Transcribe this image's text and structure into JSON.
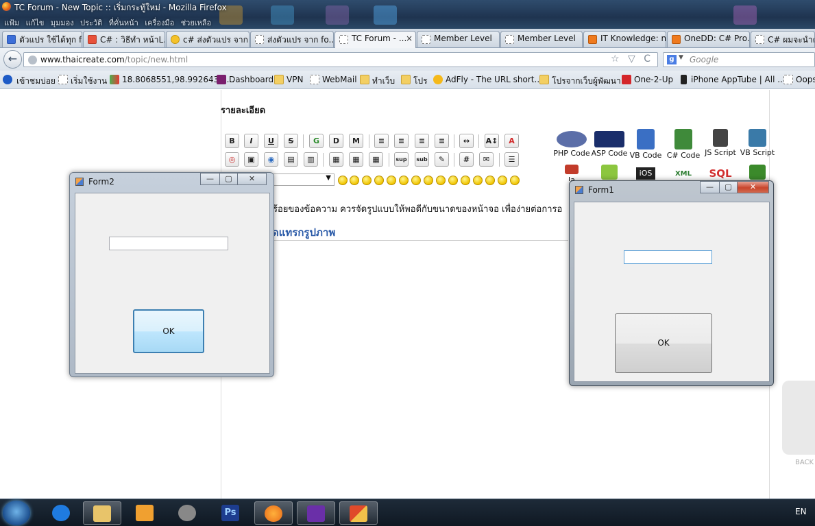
{
  "browser": {
    "window_title": "TC Forum - New Topic :: เริ่มกระทู้ใหม่ - Mozilla Firefox",
    "menu_text": "แฟ้ม แก้ไข มุมมอง ประวัติ ที่คั่นหน้า เครื่องมือ ช่วยเหลือ",
    "tabs": [
      {
        "label": "ตัวแปร ใช้ได้ทุก f...",
        "icon": "google-icon"
      },
      {
        "label": "C# : วิธีทำ หน้าL...",
        "icon": "site-icon"
      },
      {
        "label": "c# ส่งตัวแปร จาก...",
        "icon": "smiley-icon"
      },
      {
        "label": "ส่งตัวแปร จาก fo...",
        "icon": "blank-page-icon"
      },
      {
        "label": "TC Forum - ...",
        "icon": "blank-page-icon",
        "close": "×"
      },
      {
        "label": "Member Level",
        "icon": "blank-page-icon"
      },
      {
        "label": "Member Level",
        "icon": "blank-page-icon"
      },
      {
        "label": "IT Knowledge: n...",
        "icon": "blogger-icon"
      },
      {
        "label": "OneDD: C# Pro...",
        "icon": "blogger-icon"
      },
      {
        "label": "C# ผมจะนำตัว",
        "icon": "blank-page-icon"
      }
    ],
    "url_domain": "www.thaicreate.com",
    "url_path": "/topic/new.html",
    "url_tools": "☆ ▽ C",
    "search_engine_letter": "g",
    "search_placeholder": "Google",
    "bookmarks": [
      {
        "label": "เข้าชมบ่อย",
        "icon": "search-icon"
      },
      {
        "label": "เริ่มใช้งาน",
        "icon": "blank-page-icon"
      },
      {
        "label": "18.8068551,98.9926434 ...",
        "icon": "map-icon"
      },
      {
        "label": "Dashboard",
        "icon": "app-icon"
      },
      {
        "label": "VPN",
        "icon": "folder-icon"
      },
      {
        "label": "WebMail",
        "icon": "blank-page-icon"
      },
      {
        "label": "ทำเว็บ",
        "icon": "folder-icon"
      },
      {
        "label": "โปร",
        "icon": "folder-icon"
      },
      {
        "label": "AdFly - The URL short...",
        "icon": "bee-icon"
      },
      {
        "label": "โปรจากเว็บผู้พัฒนา",
        "icon": "folder-icon"
      },
      {
        "label": "One-2-Up",
        "icon": "up-icon"
      },
      {
        "label": "iPhone AppTube | All ...",
        "icon": "phone-icon"
      },
      {
        "label": "Oops",
        "icon": "blank-page-icon"
      }
    ]
  },
  "page": {
    "detail_label": "รายละเอียด",
    "toolbar_row1": [
      "B",
      "I",
      "U",
      "S",
      "G",
      "D",
      "M",
      "≡",
      "≡",
      "≡",
      "≡",
      "↔",
      "A↕",
      "A"
    ],
    "toolbar_row2": [
      "◎",
      "▣",
      "◉",
      "▤",
      "▥",
      "▦",
      "▦",
      "▦",
      "sup",
      "sub",
      "✎",
      "#",
      "✉",
      "☰"
    ],
    "help_text": "ร้อยของข้อความ ควรจัดรูปแบบให้พอดีกับขนาดของหน้าจอ เพื่อง่ายต่อการอ",
    "insert_image": "ดแทรกรูปภาพ",
    "code_links": [
      {
        "label": "PHP Code",
        "color": "#5b6ea8"
      },
      {
        "label": "ASP Code",
        "color": "#1a2e6b"
      },
      {
        "label": "VB Code",
        "color": "#3a6fc4"
      },
      {
        "label": "C# Code",
        "color": "#3f8a3a"
      },
      {
        "label": "JS Script",
        "color": "#444444"
      },
      {
        "label": "VB Script",
        "color": "#3a7aa8"
      }
    ],
    "code_links_row2": [
      {
        "label": "Ja",
        "color": "#c23b2a"
      },
      {
        "label": "",
        "color": "#8cc63f"
      },
      {
        "label": "iOS",
        "color": "#222222"
      },
      {
        "label": "XML",
        "color": "#4caf50"
      },
      {
        "label": "SQL",
        "color": "#d32f2f"
      },
      {
        "label": "",
        "color": "#3b8a2b"
      }
    ],
    "back_label": "BACK"
  },
  "form2": {
    "title": "Form2",
    "text_value": "",
    "ok_label": "OK",
    "min": "—",
    "max": "▢",
    "close": "✕"
  },
  "form1": {
    "title": "Form1",
    "text_value": "",
    "ok_label": "OK",
    "min": "—",
    "max": "▢",
    "close": "✕"
  },
  "taskbar": {
    "language": "EN",
    "apps": [
      "Internet Explorer",
      "Windows Explorer",
      "Media Player",
      "Picasa",
      "Photoshop",
      "Firefox",
      "Visual Studio",
      "Form Application"
    ],
    "app_colors": [
      "#1f7be0",
      "#e8c46a",
      "#f0a030",
      "#888888",
      "#1d3d8f",
      "#e86a1a",
      "#6a2fa8",
      "#e04a2a"
    ]
  }
}
